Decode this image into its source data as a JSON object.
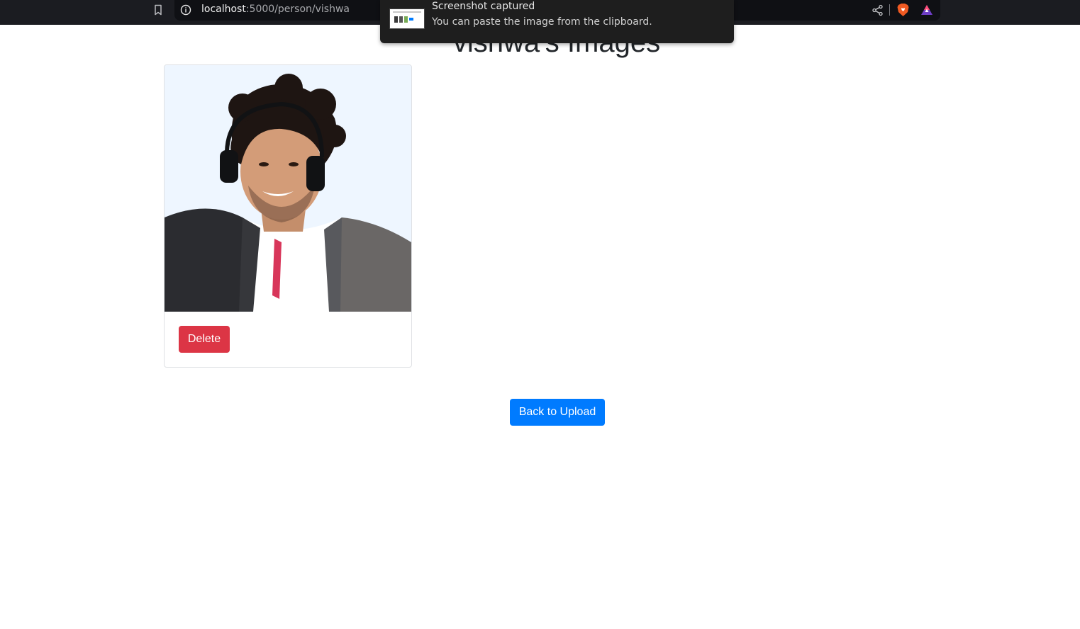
{
  "browser": {
    "url_host": "localhost",
    "url_path": ":5000/person/vishwa",
    "icons": [
      "bookmark-icon",
      "info-icon",
      "share-icon",
      "brave-icon",
      "rewards-icon"
    ]
  },
  "notification": {
    "title": "Screenshot captured",
    "body": "You can paste the image from the clipboard."
  },
  "page": {
    "title": "vishwa's Images"
  },
  "gallery": {
    "items": [
      {
        "delete_label": "Delete"
      }
    ]
  },
  "actions": {
    "back_label": "Back to Upload"
  },
  "colors": {
    "delete": "#dc3545",
    "primary": "#007bff",
    "toolbar": "#1b1c21"
  }
}
